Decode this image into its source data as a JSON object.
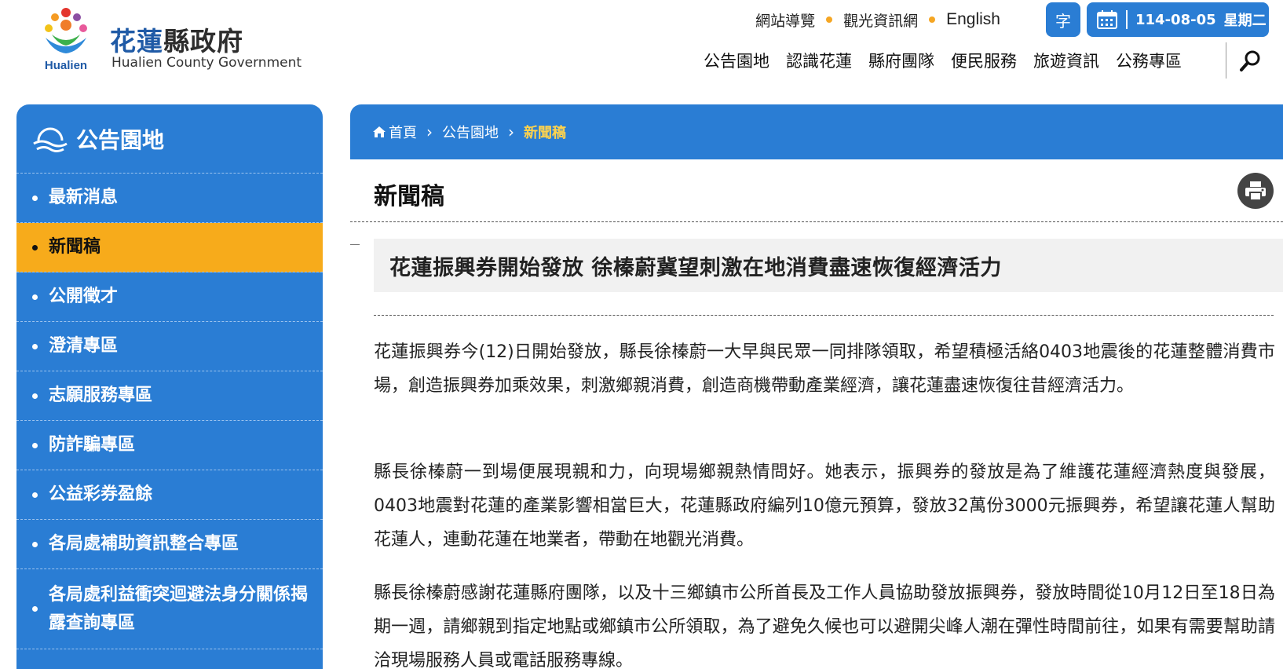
{
  "header": {
    "logo_zh_blue": "花蓮",
    "logo_zh_dark": "縣政府",
    "logo_en": "Hualien County Government",
    "logo_mark_text": "Hualien",
    "top_links": [
      "網站導覽",
      "觀光資訊網",
      "English"
    ],
    "font_size_label": "字",
    "date": "114-08-05",
    "weekday": "星期二",
    "main_nav": [
      "公告園地",
      "認識花蓮",
      "縣府團隊",
      "便民服務",
      "旅遊資訊",
      "公務專區"
    ]
  },
  "sidebar": {
    "title": "公告園地",
    "items": [
      {
        "label": "最新消息"
      },
      {
        "label": "新聞稿"
      },
      {
        "label": "公開徵才"
      },
      {
        "label": "澄清專區"
      },
      {
        "label": "志願服務專區"
      },
      {
        "label": "防詐騙專區"
      },
      {
        "label": "公益彩券盈餘"
      },
      {
        "label": "各局處補助資訊整合專區"
      },
      {
        "label": "各局處利益衝突迴避法身分關係揭露查詢專區"
      }
    ],
    "active_index": 1
  },
  "breadcrumb": [
    "首頁",
    "公告園地",
    "新聞稿"
  ],
  "page_title": "新聞稿",
  "article": {
    "title": "花蓮振興券開始發放 徐榛蔚冀望刺激在地消費盡速恢復經濟活力",
    "paragraphs": [
      "花蓮振興券今(12)日開始發放，縣長徐榛蔚一大早與民眾一同排隊領取，希望積極活絡0403地震後的花蓮整體消費市場，創造振興券加乘效果，刺激鄉親消費，創造商機帶動產業經濟，讓花蓮盡速恢復往昔經濟活力。",
      "縣長徐榛蔚一到場便展現親和力，向現場鄉親熱情問好。她表示，振興券的發放是為了維護花蓮經濟熱度與發展，0403地震對花蓮的產業影響相當巨大，花蓮縣政府編列10億元預算，發放32萬份3000元振興券，希望讓花蓮人幫助花蓮人，連動花蓮在地業者，帶動在地觀光消費。",
      "縣長徐榛蔚感謝花蓮縣府團隊，以及十三鄉鎮市公所首長及工作人員協助發放振興券，發放時間從10月12日至18日為期一週，請鄉親到指定地點或鄉鎮市公所領取，為了避免久候也可以避開尖峰人潮在彈性時間前往，如果有需要幫助請洽現場服務人員或電話服務專線。"
    ]
  },
  "colors": {
    "primary_blue": "#2a7dd4",
    "active_orange": "#f7ab1b",
    "crumb_highlight": "#ffd34d",
    "dot_accent": "#f5a623"
  }
}
